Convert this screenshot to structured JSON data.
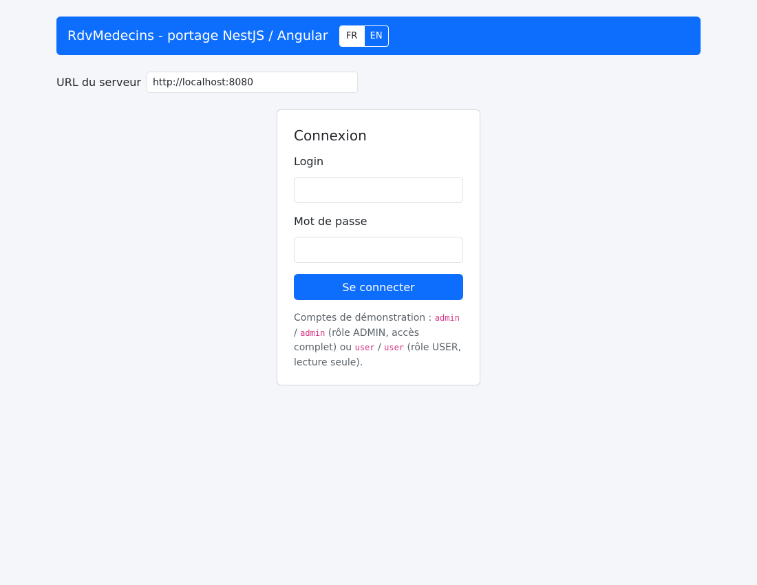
{
  "header": {
    "title": "RdvMedecins - portage NestJS / Angular",
    "languages": [
      {
        "label": "FR",
        "active": true
      },
      {
        "label": "EN",
        "active": false
      }
    ]
  },
  "server": {
    "label": "URL du serveur",
    "value": "http://localhost:8080"
  },
  "login_card": {
    "title": "Connexion",
    "login_label": "Login",
    "login_value": "",
    "password_label": "Mot de passe",
    "password_value": "",
    "submit_label": "Se connecter",
    "hint": {
      "prefix": "Comptes de démonstration :",
      "admin_login": "admin",
      "sep1": "/",
      "admin_password": "admin",
      "admin_desc": "(rôle ADMIN, accès complet) ou",
      "user_login": "user",
      "sep2": "/",
      "user_password": "user",
      "user_desc": "(rôle USER, lecture seule)."
    }
  },
  "colors": {
    "primary": "#0d6efd",
    "background": "#f5f6fa",
    "code": "#d63384"
  }
}
